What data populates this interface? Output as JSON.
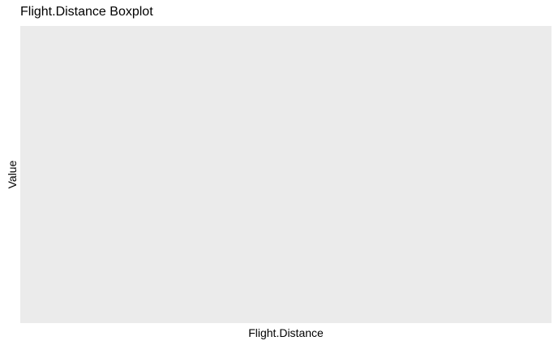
{
  "chart_data": {
    "type": "box",
    "title": "Flight.Distance Boxplot",
    "xlabel": "Flight.Distance",
    "ylabel": "Value",
    "categories": [],
    "series": [],
    "grid": false,
    "legend": "none",
    "panel_background": "#EBEBEB"
  }
}
